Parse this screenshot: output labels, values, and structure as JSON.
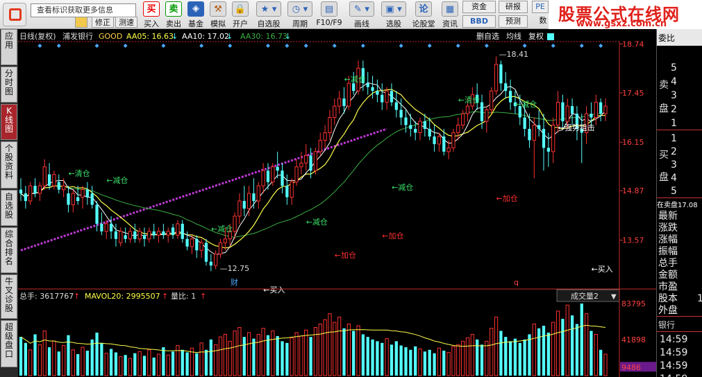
{
  "search": {
    "placeholder": "查看标识获取更多信息"
  },
  "toolbar": {
    "buy": {
      "icon": "买",
      "label": "买入"
    },
    "sell": {
      "icon": "卖",
      "label": "卖出"
    },
    "fund": {
      "label": "基金"
    },
    "sim": {
      "label": "模拟"
    },
    "open": {
      "label": "开户"
    },
    "watch": {
      "label": "自选股"
    },
    "period": {
      "label": "周期"
    },
    "f10": {
      "label": "F10/F9"
    },
    "draw": {
      "label": "画线"
    },
    "select": {
      "label": "选股"
    },
    "forum": {
      "label": "论股堂"
    },
    "news": {
      "label": "资讯"
    },
    "assets": {
      "label": "资金"
    },
    "research": {
      "label": "研报"
    },
    "bbd": {
      "label": "BBD"
    },
    "forecast": {
      "label": "预测"
    },
    "pe": {
      "label": "PE"
    },
    "data": {
      "label": "数"
    },
    "modify": {
      "label": "修正"
    },
    "test": {
      "label": "测速"
    }
  },
  "brand": {
    "title": "股票公式在线网",
    "url": "www.gsxz.com.cn"
  },
  "left_tabs": [
    {
      "label": "应\n用",
      "active": false
    },
    {
      "label": "分\n时\n图",
      "active": false
    },
    {
      "label": "K\n线\n图",
      "active": true
    },
    {
      "label": "个\n股\n资\n料",
      "active": false
    },
    {
      "label": "自\n选\n股",
      "active": false
    },
    {
      "label": "综\n合\n排\n名",
      "active": false
    },
    {
      "label": "牛\n叉\n诊\n股",
      "active": false
    },
    {
      "label": "超\n级\n盘\n口",
      "active": false
    }
  ],
  "chart_header": {
    "period": "日线(复权)",
    "stock": "浦发银行",
    "indicator": "GOOD",
    "aa05": "AA05: 16.63",
    "aa10": "AA10: 17.02",
    "aa30": "AA30: 16.73",
    "btns": [
      "删自选",
      "均线",
      "复权"
    ]
  },
  "price_axis": [
    "18.74",
    "17.45",
    "16.15",
    "14.87",
    "13.57"
  ],
  "high_label": "18.41",
  "low_label": "12.75",
  "signals": [
    {
      "text": "清仓",
      "color": "#38e06a"
    },
    {
      "text": "减仓",
      "color": "#38e06a"
    },
    {
      "text": "减仓",
      "color": "#38e06a"
    },
    {
      "text": "减仓",
      "color": "#38e06a"
    },
    {
      "text": "减仓",
      "color": "#38e06a"
    },
    {
      "text": "减仓",
      "color": "#38e06a"
    },
    {
      "text": "清仓",
      "color": "#38e06a"
    },
    {
      "text": "减仓",
      "color": "#38e06a"
    },
    {
      "text": "加仓",
      "color": "#ff3030"
    },
    {
      "text": "加仓",
      "color": "#ff3030"
    },
    {
      "text": "加仓",
      "color": "#ff3030"
    },
    {
      "text": "买入",
      "color": "#ffffff"
    },
    {
      "text": "买入",
      "color": "#ffffff"
    },
    {
      "text": "强势狙击",
      "color": "#ffffff"
    }
  ],
  "markers": {
    "cai": "财",
    "q": "q"
  },
  "volume_header": {
    "total": "总手: 3617767",
    "mavol": "MAVOL20: 2995507",
    "ratio": "量比: 1",
    "dropdown": "成交量2"
  },
  "volume_axis": [
    "83795",
    "41898",
    "9486"
  ],
  "right_panel": {
    "header": "委比",
    "sell_label_1": "卖",
    "sell_label_2": "盘",
    "buy_label_1": "买",
    "buy_label_2": "盘",
    "sell_levels": [
      "5",
      "4",
      "3",
      "2",
      "1"
    ],
    "buy_levels": [
      "1",
      "2",
      "3",
      "4",
      "5"
    ],
    "zmp": "在卖盘17.08",
    "stats": [
      "最新",
      "涨跌",
      "涨幅",
      "振幅",
      "总手",
      "金额",
      "市盈",
      "股本",
      "外盘"
    ],
    "stats_right": [
      "",
      "",
      "",
      "",
      "",
      "",
      "",
      "1",
      ""
    ],
    "bank": "银行",
    "times": [
      "14:59",
      "14:59",
      "14:59",
      "14:59"
    ]
  },
  "colors": {
    "up": "#ff3232",
    "down": "#54ffff",
    "ma5": "#ffffff",
    "ma10": "#ffff4a",
    "ma30": "#3cb043",
    "trend": "#c039d6",
    "axis": "#c82a2a"
  },
  "chart_data": {
    "type": "candlestick",
    "title": "日线(复权) 浦发银行",
    "ylim": [
      12.3,
      18.8
    ],
    "yticks": [
      18.74,
      17.45,
      16.15,
      14.87,
      13.57
    ],
    "ohlc": [
      [
        14.9,
        15.2,
        14.6,
        14.8
      ],
      [
        14.8,
        15.0,
        14.4,
        14.6
      ],
      [
        14.6,
        15.1,
        14.5,
        15.0
      ],
      [
        15.0,
        15.2,
        14.7,
        14.8
      ],
      [
        14.8,
        15.1,
        14.6,
        15.0
      ],
      [
        15.0,
        15.7,
        14.9,
        15.5
      ],
      [
        15.3,
        15.6,
        14.9,
        15.0
      ],
      [
        15.0,
        15.4,
        14.9,
        15.3
      ],
      [
        15.1,
        15.3,
        14.8,
        14.9
      ],
      [
        14.9,
        15.2,
        14.7,
        15.0
      ],
      [
        14.8,
        15.0,
        14.3,
        14.5
      ],
      [
        14.5,
        14.9,
        14.3,
        14.8
      ],
      [
        14.7,
        15.0,
        14.5,
        14.6
      ],
      [
        14.7,
        15.0,
        14.4,
        14.9
      ],
      [
        14.9,
        15.1,
        14.5,
        14.7
      ],
      [
        14.8,
        15.0,
        14.4,
        14.5
      ],
      [
        14.5,
        14.6,
        13.8,
        14.0
      ],
      [
        14.0,
        14.3,
        13.7,
        13.8
      ],
      [
        13.8,
        14.1,
        13.6,
        14.0
      ],
      [
        14.0,
        14.2,
        13.6,
        13.8
      ],
      [
        13.8,
        14.0,
        13.4,
        13.6
      ],
      [
        13.5,
        13.9,
        13.4,
        13.8
      ],
      [
        13.7,
        13.9,
        13.5,
        13.6
      ],
      [
        13.6,
        13.9,
        13.5,
        13.8
      ],
      [
        13.8,
        14.0,
        13.5,
        13.6
      ],
      [
        13.6,
        13.9,
        13.5,
        13.8
      ],
      [
        13.7,
        13.9,
        13.4,
        13.6
      ],
      [
        13.6,
        13.9,
        13.5,
        13.8
      ],
      [
        13.8,
        14.0,
        13.6,
        13.7
      ],
      [
        13.7,
        13.9,
        13.5,
        13.8
      ],
      [
        13.8,
        14.0,
        13.6,
        13.7
      ],
      [
        13.7,
        13.9,
        13.5,
        13.8
      ],
      [
        13.9,
        14.0,
        13.6,
        13.7
      ],
      [
        13.7,
        14.1,
        13.6,
        14.0
      ],
      [
        14.0,
        14.1,
        13.5,
        13.6
      ],
      [
        13.6,
        13.8,
        13.3,
        13.4
      ],
      [
        13.4,
        13.7,
        13.2,
        13.6
      ],
      [
        13.6,
        13.7,
        13.1,
        13.3
      ],
      [
        13.3,
        13.6,
        13.1,
        13.5
      ],
      [
        13.5,
        13.6,
        12.9,
        13.0
      ],
      [
        13.0,
        13.2,
        12.75,
        12.9
      ],
      [
        12.9,
        13.3,
        12.8,
        13.2
      ],
      [
        13.2,
        13.6,
        13.1,
        13.5
      ],
      [
        13.5,
        13.9,
        13.3,
        13.6
      ],
      [
        13.6,
        14.0,
        13.4,
        13.8
      ],
      [
        13.8,
        14.3,
        13.6,
        14.2
      ],
      [
        14.2,
        14.8,
        14.0,
        14.6
      ],
      [
        14.6,
        15.0,
        14.2,
        14.4
      ],
      [
        14.4,
        15.0,
        14.2,
        14.8
      ],
      [
        14.8,
        15.2,
        14.4,
        14.6
      ],
      [
        14.6,
        15.1,
        14.4,
        15.0
      ],
      [
        15.0,
        15.6,
        14.8,
        15.4
      ],
      [
        15.4,
        15.6,
        14.9,
        15.1
      ],
      [
        15.1,
        15.6,
        15.0,
        15.5
      ],
      [
        15.5,
        15.9,
        15.2,
        15.4
      ],
      [
        15.4,
        15.6,
        14.8,
        15.0
      ],
      [
        15.0,
        15.3,
        14.5,
        14.7
      ],
      [
        14.7,
        15.2,
        14.5,
        15.1
      ],
      [
        15.1,
        15.7,
        15.0,
        15.5
      ],
      [
        15.5,
        15.9,
        15.3,
        15.6
      ],
      [
        15.6,
        16.1,
        15.4,
        15.8
      ],
      [
        15.8,
        16.0,
        15.2,
        15.4
      ],
      [
        15.4,
        16.0,
        15.3,
        15.9
      ],
      [
        15.9,
        16.4,
        15.8,
        16.2
      ],
      [
        16.2,
        16.6,
        16.0,
        16.4
      ],
      [
        16.4,
        17.0,
        16.2,
        16.8
      ],
      [
        16.8,
        17.3,
        16.6,
        17.1
      ],
      [
        17.1,
        17.5,
        16.9,
        17.3
      ],
      [
        17.3,
        17.6,
        16.9,
        17.1
      ],
      [
        17.1,
        17.9,
        17.0,
        17.7
      ],
      [
        17.7,
        18.0,
        17.4,
        17.5
      ],
      [
        17.5,
        18.3,
        17.4,
        18.1
      ],
      [
        18.1,
        18.3,
        17.5,
        17.7
      ],
      [
        17.7,
        18.0,
        17.4,
        17.6
      ],
      [
        17.6,
        17.9,
        17.3,
        17.5
      ],
      [
        17.5,
        17.8,
        17.2,
        17.4
      ],
      [
        17.4,
        17.7,
        17.0,
        17.2
      ],
      [
        17.2,
        17.6,
        17.0,
        17.5
      ],
      [
        17.5,
        17.7,
        17.1,
        17.2
      ],
      [
        17.2,
        17.5,
        16.8,
        17.0
      ],
      [
        17.0,
        17.3,
        16.6,
        16.8
      ],
      [
        16.8,
        17.0,
        16.4,
        16.6
      ],
      [
        16.6,
        16.9,
        16.3,
        16.5
      ],
      [
        16.5,
        16.7,
        16.2,
        16.4
      ],
      [
        16.4,
        16.8,
        16.2,
        16.7
      ],
      [
        16.7,
        16.9,
        16.3,
        16.5
      ],
      [
        16.5,
        16.8,
        16.2,
        16.3
      ],
      [
        16.3,
        16.6,
        15.9,
        16.1
      ],
      [
        16.1,
        16.4,
        15.9,
        16.3
      ],
      [
        16.3,
        16.5,
        15.8,
        15.9
      ],
      [
        15.9,
        16.2,
        15.7,
        16.0
      ],
      [
        16.0,
        16.5,
        15.9,
        16.4
      ],
      [
        16.4,
        16.8,
        16.2,
        16.6
      ],
      [
        16.6,
        17.0,
        16.5,
        16.9
      ],
      [
        16.9,
        17.3,
        16.7,
        17.1
      ],
      [
        17.1,
        17.6,
        17.0,
        17.4
      ],
      [
        17.4,
        17.7,
        17.0,
        17.2
      ],
      [
        17.2,
        17.4,
        16.5,
        16.7
      ],
      [
        16.7,
        17.1,
        16.4,
        17.0
      ],
      [
        17.0,
        17.6,
        16.9,
        17.5
      ],
      [
        17.5,
        18.41,
        17.4,
        18.2
      ],
      [
        18.2,
        18.3,
        17.5,
        17.7
      ],
      [
        17.7,
        18.0,
        17.3,
        17.5
      ],
      [
        17.5,
        17.8,
        17.0,
        17.2
      ],
      [
        17.2,
        17.5,
        16.9,
        17.1
      ],
      [
        17.1,
        17.4,
        16.6,
        16.8
      ],
      [
        16.8,
        17.2,
        16.3,
        16.5
      ],
      [
        16.5,
        16.9,
        16.0,
        16.2
      ],
      [
        16.2,
        16.8,
        15.2,
        16.6
      ],
      [
        16.6,
        17.0,
        16.3,
        16.5
      ],
      [
        16.5,
        16.9,
        15.4,
        16.0
      ],
      [
        16.0,
        16.4,
        15.5,
        15.9
      ],
      [
        15.9,
        16.8,
        15.6,
        16.6
      ],
      [
        16.6,
        17.5,
        16.4,
        17.2
      ],
      [
        17.2,
        17.4,
        16.5,
        16.7
      ],
      [
        16.7,
        17.3,
        16.5,
        17.1
      ],
      [
        17.1,
        17.3,
        16.6,
        16.9
      ],
      [
        16.9,
        17.1,
        16.2,
        16.5
      ],
      [
        16.5,
        16.9,
        15.6,
        16.4
      ],
      [
        16.4,
        17.1,
        16.1,
        16.9
      ],
      [
        16.9,
        17.2,
        16.6,
        16.8
      ],
      [
        16.8,
        17.4,
        16.6,
        17.2
      ],
      [
        17.2,
        17.3,
        16.7,
        16.9
      ],
      [
        16.9,
        17.3,
        16.7,
        17.1
      ]
    ],
    "volume": [
      45000,
      38000,
      30000,
      48000,
      36000,
      52000,
      33000,
      40000,
      28000,
      35000,
      47000,
      30000,
      25000,
      33000,
      29000,
      42000,
      50000,
      38000,
      26000,
      31000,
      27000,
      22000,
      24000,
      20000,
      26000,
      28000,
      23000,
      30000,
      21000,
      25000,
      33000,
      24000,
      28000,
      35000,
      30000,
      27000,
      32000,
      26000,
      38000,
      30000,
      42000,
      36000,
      45000,
      48000,
      40000,
      52000,
      56000,
      45000,
      50000,
      43000,
      48000,
      55000,
      47000,
      52000,
      46000,
      40000,
      38000,
      44000,
      50000,
      46000,
      53000,
      45000,
      56000,
      60000,
      65000,
      72000,
      62000,
      68000,
      55000,
      60000,
      52000,
      58000,
      48000,
      45000,
      42000,
      40000,
      38000,
      43000,
      36000,
      40000,
      35000,
      33000,
      30000,
      34000,
      31000,
      28000,
      30000,
      26000,
      32000,
      29000,
      27000,
      34000,
      36000,
      40000,
      44000,
      48000,
      42000,
      36000,
      40000,
      55000,
      68000,
      52000,
      45000,
      40000,
      43000,
      38000,
      42000,
      48000,
      60000,
      55000,
      58000,
      50000,
      62000,
      75000,
      66000,
      82000,
      70000,
      60000,
      83795,
      72000,
      52000,
      48000,
      30000,
      25000
    ],
    "mavol20_level": 37000
  }
}
